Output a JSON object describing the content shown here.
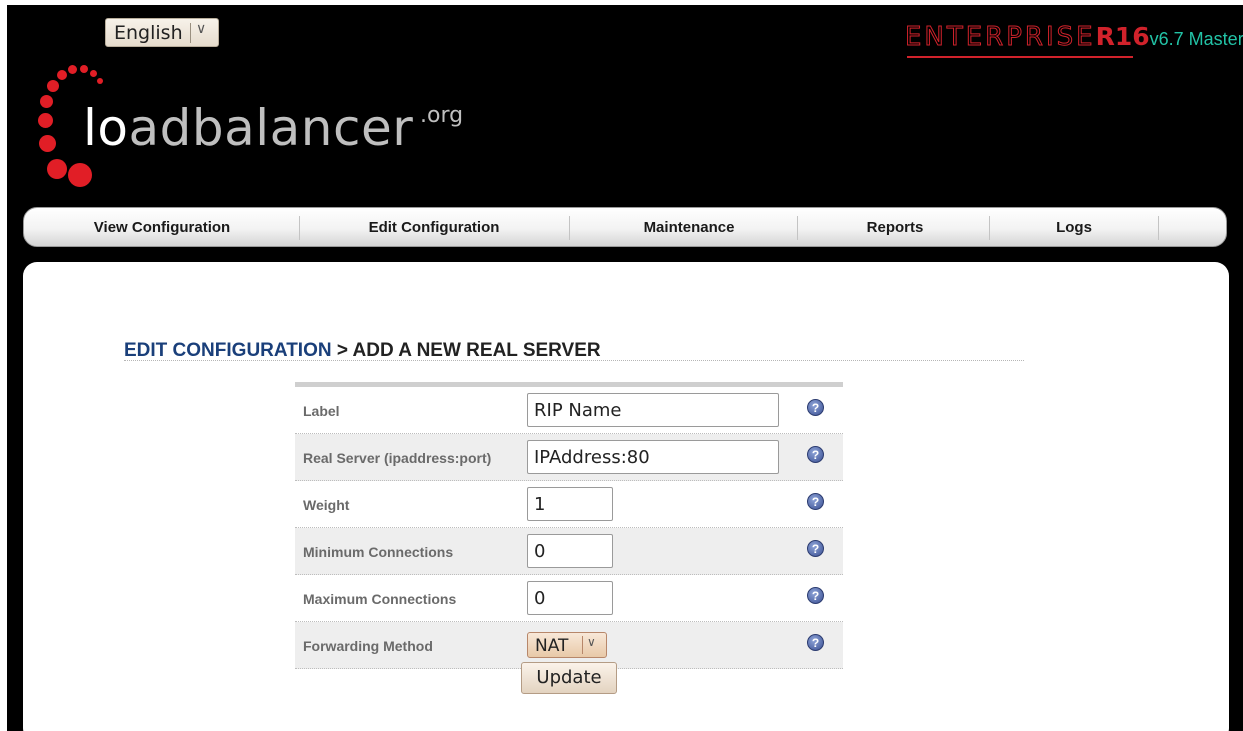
{
  "language": {
    "selected": "English"
  },
  "brand": {
    "edition": "ENTERPRISE",
    "model": "R16",
    "version": "v6.7 Master",
    "accent": "#d1222b",
    "version_color": "#22c3a6"
  },
  "logo": {
    "name_part1": "lo",
    "name_part2": "adbalancer",
    "suffix": ".org",
    "dot_color": "#e11e26"
  },
  "nav": {
    "items": [
      "View Configuration",
      "Edit Configuration",
      "Maintenance",
      "Reports",
      "Logs"
    ]
  },
  "page": {
    "crumb_section": "EDIT CONFIGURATION",
    "crumb_page": " > ADD A NEW REAL SERVER"
  },
  "form": {
    "fields": [
      {
        "label": "Label",
        "value": "RIP Name"
      },
      {
        "label": "Real Server (ipaddress:port)",
        "value": "IPAddress:80"
      },
      {
        "label": "Weight",
        "value": "1"
      },
      {
        "label": "Minimum Connections",
        "value": "0"
      },
      {
        "label": "Maximum Connections",
        "value": "0"
      },
      {
        "label": "Forwarding Method",
        "value": "NAT"
      }
    ],
    "help_glyph": "?",
    "submit_label": "Update"
  }
}
